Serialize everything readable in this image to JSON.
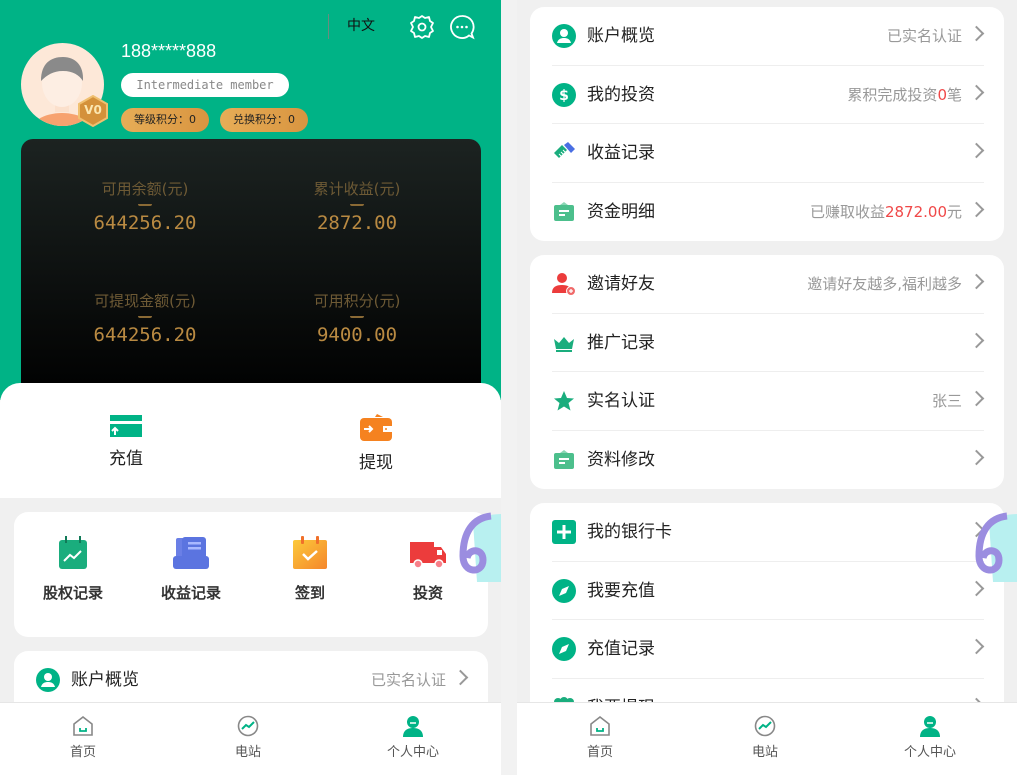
{
  "colors": {
    "brand": "#00b386",
    "highlight": "#f04848",
    "gold": "#b98a42"
  },
  "left": {
    "header": {
      "language": "中文",
      "settings_icon": "gear-icon",
      "message_icon": "chat-bubble-icon"
    },
    "user": {
      "phone": "188*****888",
      "level_badge": "V0",
      "member_level": "Intermediate member",
      "level_points": "等级积分：0",
      "exchange_points": "兑换积分：0"
    },
    "stats": [
      {
        "label": "可用余额(元)",
        "value": "644256.20"
      },
      {
        "label": "累计收益(元)",
        "value": "2872.00"
      },
      {
        "label": "可提现金额(元)",
        "value": "644256.20"
      },
      {
        "label": "可用积分(元)",
        "value": "9400.00"
      }
    ],
    "actions": [
      {
        "label": "充值",
        "icon": "card-upload-icon"
      },
      {
        "label": "提现",
        "icon": "wallet-icon"
      }
    ],
    "grid": [
      {
        "label": "股权记录",
        "icon": "chart-calendar-icon"
      },
      {
        "label": "收益记录",
        "icon": "document-stack-icon"
      },
      {
        "label": "签到",
        "icon": "check-calendar-icon"
      },
      {
        "label": "投资",
        "icon": "truck-icon"
      }
    ],
    "account_row": {
      "label": "账户概览",
      "right": "已实名认证"
    }
  },
  "right": {
    "group1": [
      {
        "label": "账户概览",
        "right": "已实名认证",
        "icon": "user-circle-icon"
      },
      {
        "label": "我的投资",
        "right_prefix": "累积完成投资",
        "right_value": "0",
        "right_suffix": "笔",
        "icon": "dollar-circle-icon"
      },
      {
        "label": "收益记录",
        "right": "",
        "icon": "handshake-icon"
      },
      {
        "label": "资金明细",
        "right_prefix": "已赚取收益",
        "right_value": "2872.00",
        "right_suffix": "元",
        "icon": "briefcase-icon"
      }
    ],
    "group2": [
      {
        "label": "邀请好友",
        "right": "邀请好友越多,福利越多",
        "icon": "add-user-icon"
      },
      {
        "label": "推广记录",
        "right": "",
        "icon": "crown-icon"
      },
      {
        "label": "实名认证",
        "right_value": "张三",
        "icon": "star-icon"
      },
      {
        "label": "资料修改",
        "right": "",
        "icon": "briefcase-icon"
      }
    ],
    "group3": [
      {
        "label": "我的银行卡",
        "icon": "plus-square-icon"
      },
      {
        "label": "我要充值",
        "icon": "compass-icon"
      },
      {
        "label": "充值记录",
        "icon": "compass-icon"
      },
      {
        "label": "我要提现",
        "icon": "group-icon"
      }
    ]
  },
  "tabbar": [
    {
      "label": "首页",
      "icon": "home-icon"
    },
    {
      "label": "电站",
      "icon": "chart-circle-icon"
    },
    {
      "label": "个人中心",
      "icon": "person-icon",
      "active": true
    }
  ]
}
